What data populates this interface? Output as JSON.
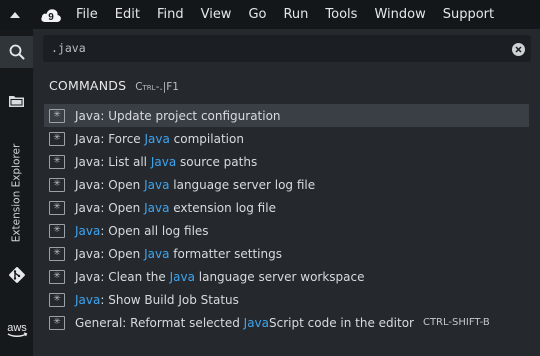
{
  "menubar": {
    "items": [
      "File",
      "Edit",
      "Find",
      "View",
      "Go",
      "Run",
      "Tools",
      "Window",
      "Support"
    ]
  },
  "sidebar": {
    "extension_explorer_label": "Extension Explorer",
    "aws_label": "aws"
  },
  "search": {
    "value": ".java",
    "placeholder": ""
  },
  "commands": {
    "title": "COMMANDS",
    "shortcut": "Ctrl-.|F1",
    "items": [
      {
        "parts": [
          "Java: Update project configuration"
        ],
        "highlight": [
          false
        ],
        "selected": true
      },
      {
        "parts": [
          "Java: Force ",
          "Java",
          " compilation"
        ],
        "highlight": [
          false,
          true,
          false
        ]
      },
      {
        "parts": [
          "Java: List all ",
          "Java",
          " source paths"
        ],
        "highlight": [
          false,
          true,
          false
        ]
      },
      {
        "parts": [
          "Java: Open ",
          "Java",
          " language server log file"
        ],
        "highlight": [
          false,
          true,
          false
        ]
      },
      {
        "parts": [
          "Java: Open ",
          "Java",
          " extension log file"
        ],
        "highlight": [
          false,
          true,
          false
        ]
      },
      {
        "parts": [
          "Java",
          ": Open all log files"
        ],
        "highlight": [
          true,
          false
        ]
      },
      {
        "parts": [
          "Java: Open ",
          "Java",
          " formatter settings"
        ],
        "highlight": [
          false,
          true,
          false
        ]
      },
      {
        "parts": [
          "Java: Clean the ",
          "Java",
          " language server workspace"
        ],
        "highlight": [
          false,
          true,
          false
        ]
      },
      {
        "parts": [
          "Java",
          ": Show Build Job Status"
        ],
        "highlight": [
          true,
          false
        ]
      },
      {
        "parts": [
          "General: Reformat selected ",
          "Java",
          "Script code in the editor"
        ],
        "highlight": [
          false,
          true,
          false
        ],
        "shortcut": "CTRL-SHIFT-B"
      }
    ]
  },
  "colors": {
    "highlight": "#3ea4ef",
    "selected_row": "#3a3f45",
    "menubar_bg": "#14171a",
    "palette_bg": "#25292e"
  },
  "icons": {
    "menu_caret": "caret-up-icon",
    "logo": "cloud9-logo-icon",
    "search": "search-icon",
    "files": "folder-icon",
    "git": "git-icon",
    "aws": "aws-logo",
    "clear": "clear-icon",
    "command": "command-icon"
  }
}
